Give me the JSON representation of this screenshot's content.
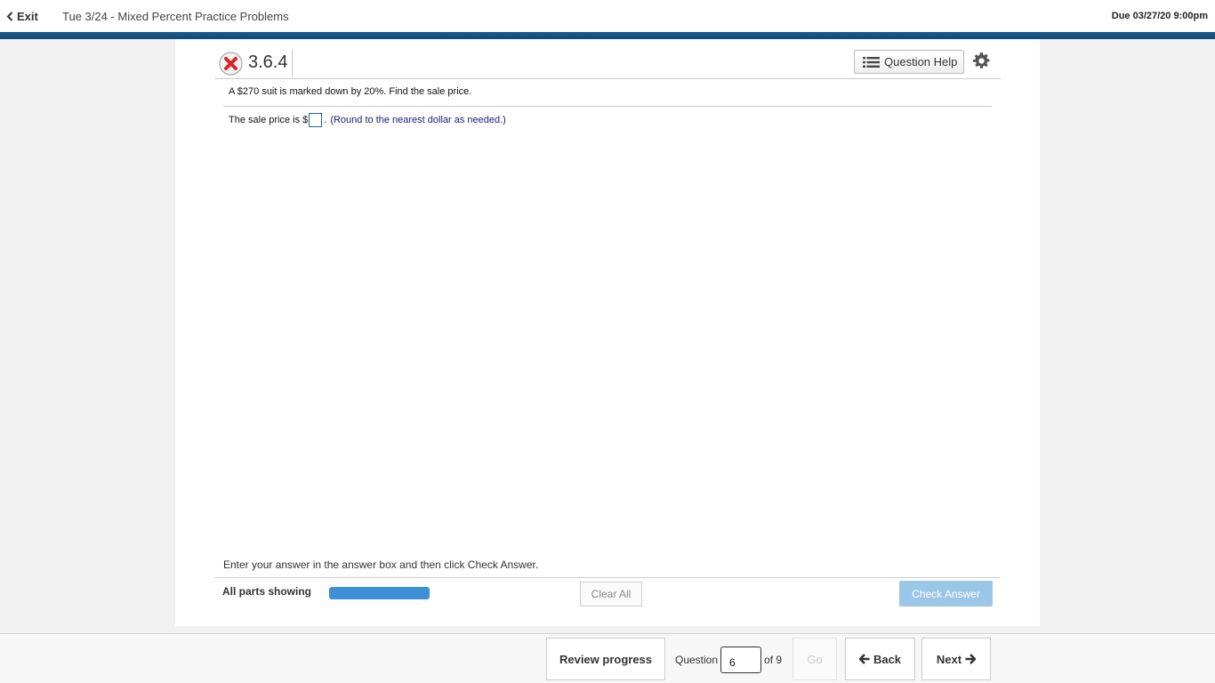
{
  "header": {
    "exit_label": "Exit",
    "assignment_title": "Tue 3/24 - Mixed Percent Practice Problems",
    "due": "Due 03/27/20 9:00pm"
  },
  "question": {
    "number": "3.6.4",
    "status_icon": "incorrect-x-icon",
    "help_label": "Question Help",
    "prompt": "A $270 suit is marked down by 20%. Find the sale price.",
    "answer_prefix": "The sale price is $",
    "answer_value": "",
    "answer_suffix": ".",
    "hint": "(Round to the nearest dollar as needed.)"
  },
  "panel_footer": {
    "instruction": "Enter your answer in the answer box and then click Check Answer.",
    "parts_label": "All parts showing",
    "parts_progress": 1.0,
    "clear_label": "Clear All",
    "check_label": "Check Answer"
  },
  "footer": {
    "review_label": "Review progress",
    "question_label": "Question",
    "question_value": "6",
    "of_label": "of 9",
    "go_label": "Go",
    "back_label": "Back",
    "next_label": "Next"
  },
  "colors": {
    "header_stripe": "#1b5c8c",
    "progress_bar": "#3d8fd6",
    "check_button": "#9cc6e7",
    "incorrect_icon": "#d9252a"
  }
}
